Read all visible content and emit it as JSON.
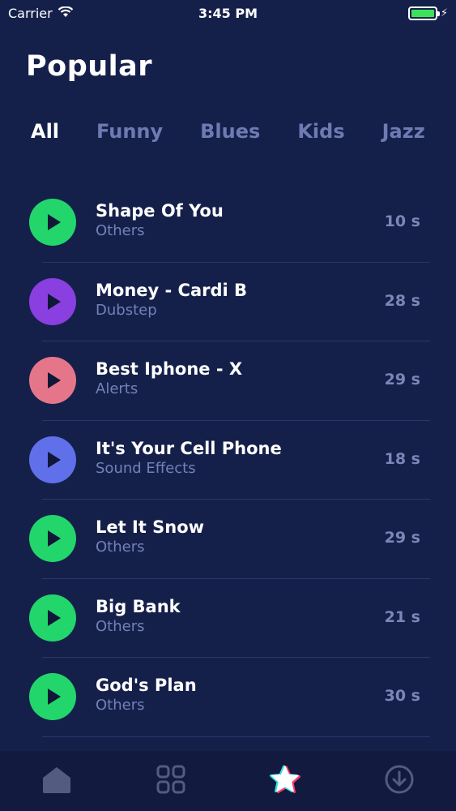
{
  "status_bar": {
    "carrier": "Carrier",
    "time": "3:45 PM"
  },
  "page": {
    "title": "Popular"
  },
  "tabs": [
    {
      "label": "All",
      "active": true
    },
    {
      "label": "Funny",
      "active": false
    },
    {
      "label": "Blues",
      "active": false
    },
    {
      "label": "Kids",
      "active": false
    },
    {
      "label": "Jazz",
      "active": false
    }
  ],
  "ringtones": [
    {
      "title": "Shape Of You",
      "category": "Others",
      "duration": "10 s",
      "color": "#22d66b"
    },
    {
      "title": "Money - Cardi B",
      "category": "Dubstep",
      "duration": "28 s",
      "color": "#8a3fe0"
    },
    {
      "title": "Best Iphone - X",
      "category": "Alerts",
      "duration": "29 s",
      "color": "#e5768a"
    },
    {
      "title": "It's Your Cell Phone",
      "category": "Sound Effects",
      "duration": "18 s",
      "color": "#5f70ea"
    },
    {
      "title": "Let It Snow",
      "category": "Others",
      "duration": "29 s",
      "color": "#22d66b"
    },
    {
      "title": "Big Bank",
      "category": "Others",
      "duration": "21 s",
      "color": "#22d66b"
    },
    {
      "title": "God's Plan",
      "category": "Others",
      "duration": "30 s",
      "color": "#22d66b"
    }
  ],
  "tabbar": {
    "items": [
      {
        "icon": "home-icon"
      },
      {
        "icon": "grid-icon"
      },
      {
        "icon": "star-icon",
        "active": true
      },
      {
        "icon": "download-icon"
      }
    ]
  },
  "colors": {
    "background": "#15204a",
    "tab_inactive": "#6f7ab3",
    "subtext": "#7480b8",
    "battery": "#3ee05a"
  }
}
